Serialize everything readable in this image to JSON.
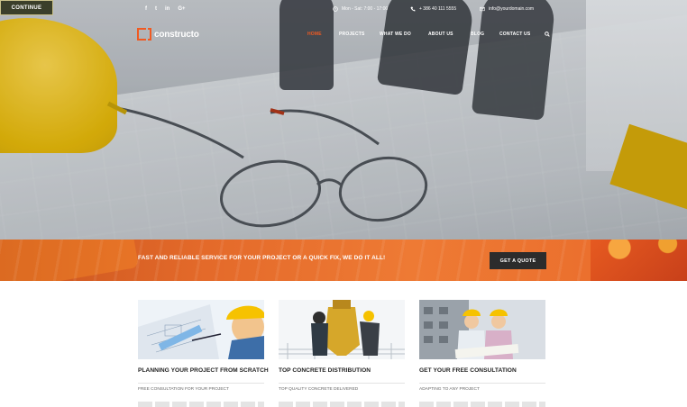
{
  "continue_label": "CONTINUE",
  "topbar": {
    "social": [
      "f",
      "t",
      "in",
      "G+"
    ],
    "hours": "Mon - Sat: 7:00 - 17:00",
    "phone": "+ 386 40 111 5555",
    "email": "info@yourdomain.com"
  },
  "brand": {
    "name": "constructo",
    "accent": "#f05a22"
  },
  "nav": {
    "items": [
      "HOME",
      "PROJECTS",
      "WHAT WE DO",
      "ABOUT US",
      "BLOG",
      "CONTACT US"
    ],
    "active": "HOME",
    "search_icon": "search-icon"
  },
  "banner": {
    "text": "FAST AND RELIABLE SERVICE FOR YOUR PROJECT OR A QUICK FIX, WE DO IT ALL!",
    "button": "GET A QUOTE"
  },
  "cards": [
    {
      "title": "PLANNING YOUR PROJECT FROM SCRATCH",
      "subtitle": "FREE CONSULTATION FOR YOUR PROJECT"
    },
    {
      "title": "TOP CONCRETE DISTRIBUTION",
      "subtitle": "TOP QUALITY CONCRETE DELIVERED"
    },
    {
      "title": "GET YOUR FREE CONSULTATION",
      "subtitle": "ADAPTING TO ANY PROJECT"
    }
  ]
}
